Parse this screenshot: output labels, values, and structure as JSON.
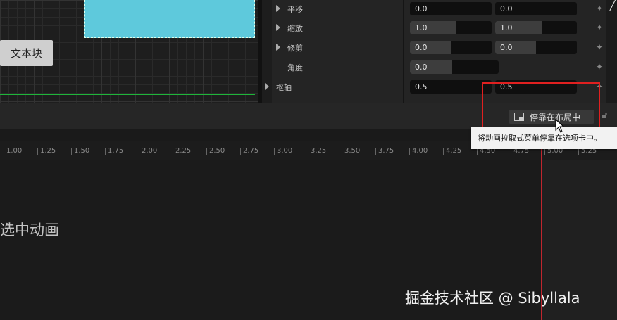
{
  "canvas": {
    "text_block_label": "文本块"
  },
  "details": {
    "rows": [
      {
        "label": "平移",
        "x": "0.0",
        "y": "0.0",
        "has_expander": true
      },
      {
        "label": "缩放",
        "x": "1.0",
        "y": "1.0",
        "has_expander": true
      },
      {
        "label": "修剪",
        "x": "0.0",
        "y": "0.0",
        "has_expander": true
      },
      {
        "label": "角度",
        "x": "0.0",
        "has_expander": false
      },
      {
        "label": "枢轴",
        "x": "0.5",
        "y": "0.5",
        "has_expander": true
      }
    ]
  },
  "toolbar": {
    "dock_button_label": "停靠在布局中",
    "tooltip": "将动画拉取式菜单停靠在选项卡中。"
  },
  "timeline": {
    "ticks": [
      "1.00",
      "1.25",
      "1.50",
      "1.75",
      "2.00",
      "2.25",
      "2.50",
      "2.75",
      "3.00",
      "3.25",
      "3.50",
      "3.75",
      "4.00",
      "4.25",
      "4.50",
      "4.75",
      "5.00",
      "5.25"
    ]
  },
  "animation": {
    "empty_message": "选中动画"
  },
  "watermark": "掘金技术社区 @ Sibyllala",
  "colors": {
    "widget_block": "#5ec9dc",
    "highlight_box": "#e02020",
    "playhead": "#c0262e",
    "guide_line": "#1fb53a"
  }
}
